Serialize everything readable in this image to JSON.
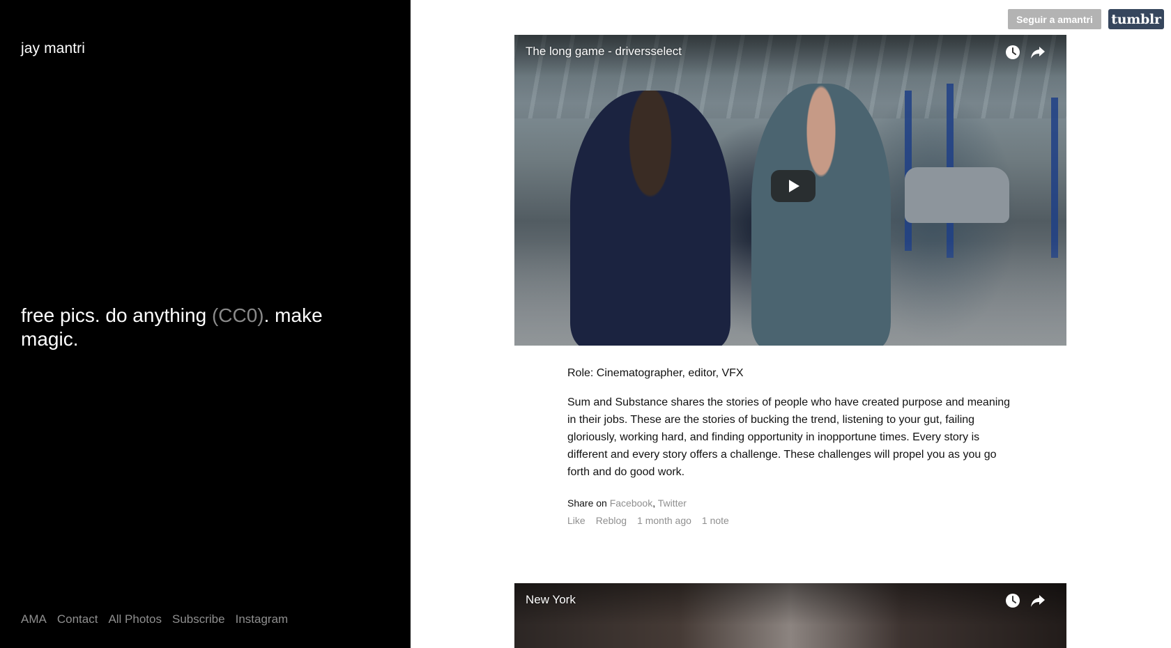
{
  "sidebar": {
    "blog_title": "jay mantri",
    "tagline_part1": "free pics. do anything ",
    "tagline_cc": "(CC0)",
    "tagline_part2": ". make magic.",
    "nav": [
      "AMA",
      "Contact",
      "All Photos",
      "Subscribe",
      "Instagram"
    ]
  },
  "top_controls": {
    "follow_label": "Seguir a amantri",
    "logo_text": "tumblr"
  },
  "posts": [
    {
      "video_title": "The long game - driversselect",
      "role": "Role: Cinematographer, editor, VFX",
      "description": "Sum and Substance shares the stories of people who have created purpose and meaning in their jobs. These are the stories of bucking the trend, listening to your gut, failing gloriously, working hard, and finding opportunity in inopportune times. Every story is different and every story offers a challenge. These challenges will propel you as you go forth and do good work.",
      "share_prefix": "Share on ",
      "share_facebook": "Facebook",
      "share_sep": ",",
      "share_twitter": "Twitter",
      "like_label": "Like",
      "reblog_label": "Reblog",
      "timestamp": "1 month ago",
      "notes": "1 note"
    },
    {
      "video_title": "New York"
    }
  ],
  "colors": {
    "sidebar_bg": "#000000",
    "link_grey": "#8f8f8f",
    "follow_bg": "#b3b3b3",
    "tumblr_bg": "#36465d"
  },
  "icons": {
    "watch_later": "clock-icon",
    "share": "share-arrow-icon",
    "play": "play-icon"
  }
}
